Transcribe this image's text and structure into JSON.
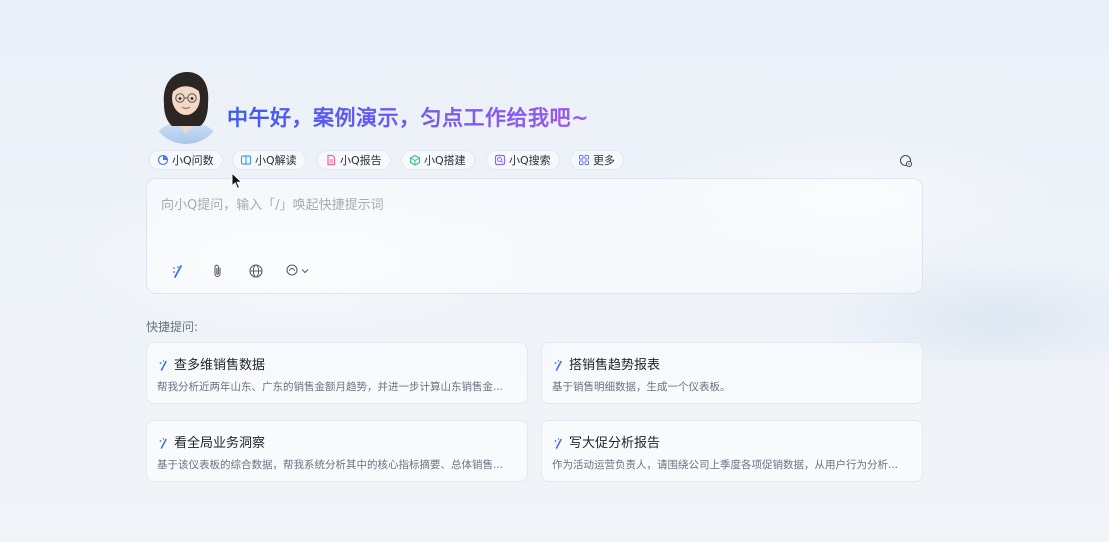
{
  "greeting": {
    "text": "中午好，案例演示，匀点工作给我吧~"
  },
  "chips": [
    {
      "label": "小Q问数",
      "icon": "chart-icon"
    },
    {
      "label": "小Q解读",
      "icon": "book-icon"
    },
    {
      "label": "小Q报告",
      "icon": "report-icon"
    },
    {
      "label": "小Q搭建",
      "icon": "cube-icon"
    },
    {
      "label": "小Q搜索",
      "icon": "search-icon"
    },
    {
      "label": "更多",
      "icon": "grid-icon"
    }
  ],
  "input": {
    "placeholder": "向小Q提问，输入「/」唤起快捷提示词"
  },
  "quick": {
    "title": "快捷提问:",
    "cards": [
      {
        "title": "查多维销售数据",
        "desc": "帮我分析近两年山东、广东的销售金额月趋势，并进一步计算山东销售金..."
      },
      {
        "title": "搭销售趋势报表",
        "desc": "基于销售明细数据，生成一个仪表板。"
      },
      {
        "title": "看全局业务洞察",
        "desc": "基于该仪表板的综合数据，帮我系统分析其中的核心指标摘要、总体销售..."
      },
      {
        "title": "写大促分析报告",
        "desc": "作为活动运营负责人，请围绕公司上季度各项促销数据，从用户行为分析..."
      }
    ]
  },
  "colors": {
    "accent": "#3d5bf0",
    "accent2": "#9c59f0"
  }
}
